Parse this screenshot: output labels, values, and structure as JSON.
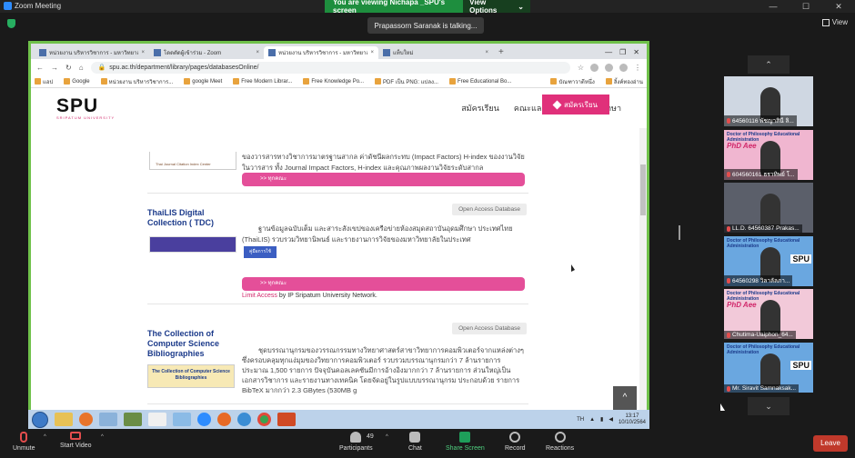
{
  "zoom": {
    "title": "Zoom Meeting",
    "viewing_banner": "You are viewing Nichapa _SPU's screen",
    "view_options": "View Options",
    "talking": "Prapassorn Saranak is talking...",
    "view_label": "View",
    "window_controls": [
      "—",
      "☐",
      "✕"
    ]
  },
  "browser": {
    "tabs": [
      {
        "label": "หน่วยงาน บริหารวิชาการ - มหาวิทยาลัย",
        "active": false
      },
      {
        "label": "โดดตัดผู้เข้าร่วม - Zoom",
        "active": false
      },
      {
        "label": "หน่วยงาน บริหารวิชาการ - มหาวิทยาลัย",
        "active": true
      },
      {
        "label": "แท็บใหม่",
        "active": false
      }
    ],
    "new_tab": "+",
    "url": "spu.ac.th/department/library/pages/databasesOnline/",
    "bookmarks": [
      "แอป",
      "Google",
      "หน่วยงาน บริหารวิชาการ...",
      "google Meet",
      "Free Modern Librar...",
      "Free Knowledge Po...",
      "PDF เป็น PNG: แปลง...",
      "Free Educational Bo..."
    ],
    "bookmarks_right": [
      "บัณฑาวาตีหนึ่ง",
      "ลิ้งค์ทองอ่าน"
    ]
  },
  "site": {
    "brand": "SPU",
    "brand_sub": "SRIPATUM UNIVERSITY",
    "nav": [
      "สมัครเรียน",
      "คณะและหลักสูตร",
      "นักศึกษา"
    ],
    "apply_button": "สมัครเรียน",
    "section0": {
      "logo_caption": "Thai Journal Citation Index Center",
      "body": "ของวารสารทางวิชาการมาตรฐานสากล ค่าดัชนีผลกระทบ (Impact Factors) H-index ของงานวิจัยในวารสาร ทั้ง Journal Impact Factors, H-index และคุณภาพผลงานวิจัยระดับสากล",
      "more": ">> ทุกคณะ"
    },
    "section1": {
      "title": "ThaiLIS Digital Collection ( TDC)",
      "badge": "Open Access Database",
      "desc": "ฐานข้อมูลฉบับเต็ม และสาระสังเขปของเครือข่ายห้องสมุดสถาบันอุดมศึกษา ประเทศไทย (ThaiLIS) รวบรวมวิทยานิพนธ์ และรายงานการวิจัยของมหาวิทยาลัยในประเทศ",
      "guide": "คู่มือการใช้",
      "more": ">> ทุกคณะ",
      "access_red": "Limit Access",
      "access_rest": " by IP Sripatum University Network."
    },
    "section2": {
      "title": "The Collection of Computer Science Bibliographies",
      "badge": "Open Access Database",
      "thumb_caption": "The Collection of Computer Science Bibliographies",
      "desc": "ชุดบรรณานุกรมของวรรณกรรมทางวิทยาศาสตร์สาขาวิทยาการคอมพิวเตอร์จากแหล่งต่างๆ ซึ่งครอบคลุมทุกแง่มุมของวิทยาการคอมพิวเตอร์ รวบรวมบรรณานุกรมกว่า 7 ล้านรายการ ประมาณ 1,500 รายการ ปัจจุบันคอลเลคชันมีการอ้างอิงมากกว่า 7 ล้านรายการ ส่วนใหญ่เป็นเอกสารวิชาการ และรายงานทางเทคนิค โดยจัดอยู่ในรูปแบบบรรณานุกรม ประกอบด้วย รายการ BibTeX มากกว่า 2.3 GBytes (530MB g"
    },
    "to_top": "^"
  },
  "taskbar": {
    "lang": "TH",
    "time": "13:17",
    "date": "10/10/2564"
  },
  "gallery": [
    {
      "name": "64560116 พัชญาสินี ลิ...",
      "label": "",
      "tag": ""
    },
    {
      "name": "604560161 ธราทิพย์ โ...",
      "label": "Doctor of Philosophy Educational Administration",
      "tag": "PhD Aee"
    },
    {
      "name": "LL.D. 64560387 Prakas...",
      "label": "",
      "tag": ""
    },
    {
      "name": "64560298 วิลาลัลภา...",
      "label": "Doctor of Philosophy Educational Administration",
      "tag": "SPU"
    },
    {
      "name": "Chutima-Uaiphon_64...",
      "label": "Doctor of Philosophy Educational Administration",
      "tag": "PhD Aee"
    },
    {
      "name": "Mr. Siravit Samnaksak...",
      "label": "Doctor of Philosophy Educational Administration",
      "tag": "SPU"
    }
  ],
  "toolbar": {
    "unmute": "Unmute",
    "start_video": "Start Video",
    "participants": "Participants",
    "participants_count": "49",
    "chat": "Chat",
    "share_screen": "Share Screen",
    "record": "Record",
    "reactions": "Reactions",
    "leave": "Leave"
  }
}
